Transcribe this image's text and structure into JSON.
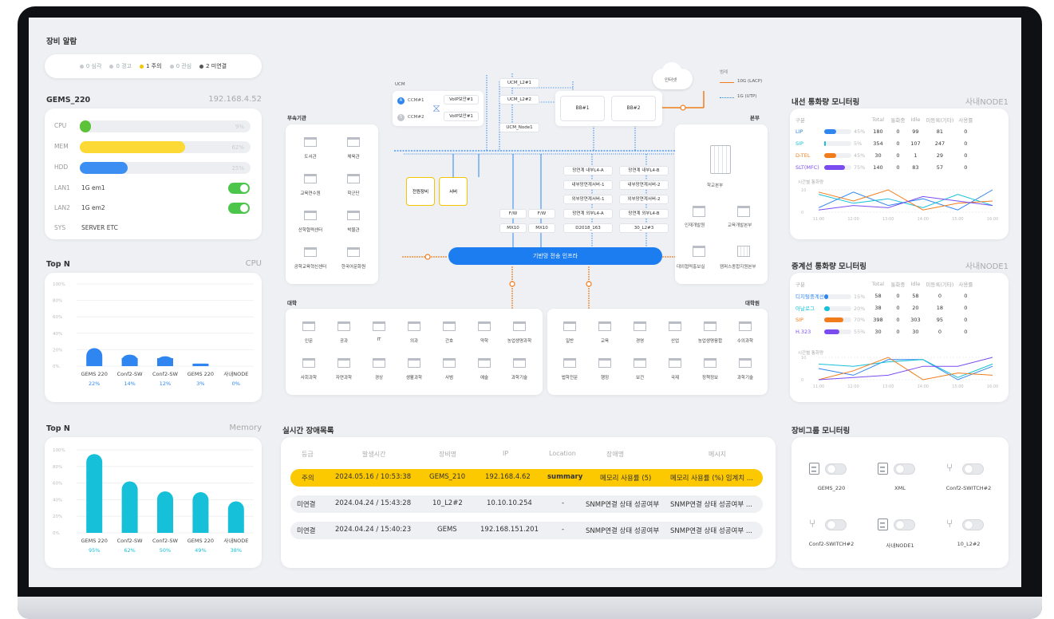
{
  "alarm": {
    "title": "장비 알람",
    "items": [
      {
        "label": "0 심각",
        "color": "#c7cbd1"
      },
      {
        "label": "0 경고",
        "color": "#c7cbd1"
      },
      {
        "label": "1 주의",
        "color": "#f2c500"
      },
      {
        "label": "0 관심",
        "color": "#c7cbd1"
      },
      {
        "label": "2 미연결",
        "color": "#555"
      }
    ]
  },
  "gems": {
    "title": "GEMS_220",
    "ip": "192.168.4.52",
    "rows": [
      {
        "label": "CPU",
        "percent": "9%",
        "fraction": 0.09,
        "color": "#5cc23a"
      },
      {
        "label": "MEM",
        "percent": "62%",
        "fraction": 0.62,
        "color": "#fcd934"
      },
      {
        "label": "HDD",
        "percent": "25%",
        "fraction": 0.25,
        "color": "#3c8ef2"
      }
    ],
    "lan1": {
      "label": "LAN1",
      "value": "1G em1",
      "on": true
    },
    "lan2": {
      "label": "LAN2",
      "value": "1G em2",
      "on": true
    },
    "sys": {
      "label": "SYS",
      "value": "SERVER ETC"
    }
  },
  "topn_cpu": {
    "title": "Top N",
    "subtitle": "CPU",
    "yticks": [
      "100%",
      "80%",
      "60%",
      "40%",
      "20%",
      "0%"
    ]
  },
  "topn_mem": {
    "title": "Top N",
    "subtitle": "Memory",
    "yticks": [
      "100%",
      "80%",
      "60%",
      "40%",
      "20%",
      "0%"
    ]
  },
  "chart_data": [
    {
      "type": "bar",
      "title": "Top N",
      "subtitle": "CPU",
      "categories": [
        "GEMS 220",
        "Conf2-SW",
        "Conf2-SW",
        "GEMS 220",
        "사내NODE"
      ],
      "values": [
        22,
        14,
        12,
        3,
        0
      ],
      "value_labels": [
        "22%",
        "14%",
        "12%",
        "3%",
        "0%"
      ],
      "ylim": [
        0,
        100
      ],
      "color": "#2f86f0"
    },
    {
      "type": "bar",
      "title": "Top N",
      "subtitle": "Memory",
      "categories": [
        "GEMS 220",
        "Conf2-SW",
        "Conf2-SW",
        "GEMS 220",
        "사내NODE"
      ],
      "values": [
        95,
        62,
        50,
        49,
        38
      ],
      "value_labels": [
        "95%",
        "62%",
        "50%",
        "49%",
        "38%"
      ],
      "ylim": [
        0,
        100
      ],
      "color": "#16c0d8"
    },
    {
      "type": "line",
      "title": "시간별 통화량",
      "x": [
        "11:00",
        "12:00",
        "13:00",
        "14:00",
        "15:00",
        "16:00"
      ],
      "yticks": [
        "10",
        "0"
      ],
      "ylim": [
        0,
        10
      ],
      "series": [
        {
          "color": "#2f86f0",
          "values": [
            2,
            9,
            3,
            6,
            1,
            10
          ]
        },
        {
          "color": "#16c0d8",
          "values": [
            8,
            4,
            6,
            2,
            8,
            3
          ]
        },
        {
          "color": "#f07c1b",
          "values": [
            9,
            5,
            10,
            1,
            4,
            5
          ]
        },
        {
          "color": "#7a4cf0",
          "values": [
            1,
            3,
            2,
            7,
            5,
            3
          ]
        }
      ]
    },
    {
      "type": "line",
      "title": "시간별 통화량",
      "x": [
        "11:00",
        "12:00",
        "13:00",
        "14:00",
        "15:00",
        "16:00"
      ],
      "yticks": [
        "10",
        "0"
      ],
      "ylim": [
        0,
        10
      ],
      "series": [
        {
          "color": "#2f86f0",
          "values": [
            5,
            2,
            9,
            9,
            0,
            6
          ]
        },
        {
          "color": "#16c0d8",
          "values": [
            7,
            6,
            8,
            9,
            1,
            7
          ]
        },
        {
          "color": "#f07c1b",
          "values": [
            0,
            4,
            10,
            0,
            3,
            2
          ]
        },
        {
          "color": "#7a4cf0",
          "values": [
            0,
            1,
            2,
            6,
            6,
            10
          ]
        }
      ]
    }
  ],
  "network": {
    "ucm": "UCM",
    "ccm1": "CCM#1",
    "ccm2": "CCM#2",
    "voip1": "VoIP보안#1",
    "voip2": "VoIP보안#1",
    "ucm_l2_1": "UCM_L2#1",
    "ucm_l2_2": "UCM_L2#2",
    "ucm_node1": "UCM_Node1",
    "bb1": "BB#1",
    "bb2": "BB#2",
    "internet": "인터넷",
    "legend_title": "범례",
    "legend_10g": "10G (LACP)",
    "legend_1g": "1G (UTP)",
    "affiliates_title": "부속기관",
    "affiliates": [
      "도서관",
      "체육관",
      "교육연수원",
      "학군단",
      "산학협력센터",
      "박물관",
      "공학교육혁신센터",
      "한국어문화원"
    ],
    "hq_title": "본부",
    "hq_main": "학교본부",
    "hq_items": [
      "인재개발원",
      "교육개발본부",
      "대외협력홍보실",
      "캠퍼스종합지원본부"
    ],
    "power": "전원장비",
    "server": "서버",
    "fw1": "F/W",
    "fw2": "F/W",
    "mx1": "MX10",
    "mx2": "MX10",
    "nodes_left": [
      "망연계 내부L4-A",
      "내부망연계서버-1",
      "외부망연계서버-1",
      "망연계 외부L4-A",
      "D2018_163"
    ],
    "nodes_right": [
      "망연계 내부L4-B",
      "내부망연계서버-2",
      "외부망연계서버-2",
      "망연계 외부L4-B",
      "30_L2#3"
    ],
    "backbone": "기반망 전송 인프라",
    "univ_title": "대학",
    "univ_row1": [
      "인문",
      "공과",
      "IT",
      "의과",
      "간호",
      "약학",
      "농업생명과학"
    ],
    "univ_row2": [
      "사회과학",
      "자연과학",
      "경상",
      "생활과학",
      "사범",
      "예술",
      "과학기술"
    ],
    "grad_title": "대학원",
    "grad_row1": [
      "일반",
      "교육",
      "경영",
      "산업",
      "농업생명융합",
      "수의과학"
    ],
    "grad_row2": [
      "법학전문",
      "행정",
      "보건",
      "국제",
      "정책정보",
      "과학기술"
    ]
  },
  "realtime": {
    "title": "실시간 장애목록",
    "headers": [
      "등급",
      "발생시간",
      "장비명",
      "IP",
      "Location",
      "장애명",
      "메시지"
    ],
    "rows": [
      {
        "grade": "주의",
        "time": "2024.05.16 / 10:53:38",
        "device": "GEMS_210",
        "ip": "192.168.4.62",
        "location": "summary",
        "name": "메모리 사용률 (5)",
        "msg": "메모리 사용률 (%) 임계치 ...",
        "highlight": true
      },
      {
        "grade": "미연결",
        "time": "2024.04.24 / 15:43:28",
        "device": "10_L2#2",
        "ip": "10.10.10.254",
        "location": "-",
        "name": "SNMP연결 상태 성공여부",
        "msg": "SNMP연결 상태 성공여부 ...",
        "highlight": false
      },
      {
        "grade": "미연결",
        "time": "2024.04.24 / 15:40:23",
        "device": "GEMS",
        "ip": "192.168.151.201",
        "location": "-",
        "name": "SNMP연결 상태 성공여부",
        "msg": "SNMP연결 상태 성공여부 ...",
        "highlight": false
      }
    ]
  },
  "inner_call": {
    "title": "내선 통화량 모니터링",
    "node": "사내NODE1",
    "headers": [
      "구분",
      "Total",
      "통화중",
      "Idle",
      "미등록(기타)",
      "사용률"
    ],
    "rows": [
      {
        "name": "LIP",
        "color": "#2f86f0",
        "pct": "45%",
        "fill": 0.45,
        "total": "180",
        "busy": "0",
        "idle": "99",
        "unreg": "81",
        "use": "0"
      },
      {
        "name": "SIP",
        "color": "#16c0d8",
        "pct": "5%",
        "fill": 0.05,
        "total": "354",
        "busy": "0",
        "idle": "107",
        "unreg": "247",
        "use": "0"
      },
      {
        "name": "D-TEL",
        "color": "#f07c1b",
        "pct": "45%",
        "fill": 0.45,
        "total": "30",
        "busy": "0",
        "idle": "1",
        "unreg": "29",
        "use": "0"
      },
      {
        "name": "SLT(MFC)",
        "color": "#7a4cf0",
        "pct": "75%",
        "fill": 0.75,
        "total": "140",
        "busy": "0",
        "idle": "83",
        "unreg": "57",
        "use": "0"
      }
    ],
    "chart_title": "시간별 통화량"
  },
  "trunk_call": {
    "title": "중계선 통화량 모니터링",
    "node": "사내NODE1",
    "headers": [
      "구분",
      "Total",
      "통화중",
      "Idle",
      "미등록(기타)",
      "사용률"
    ],
    "rows": [
      {
        "name": "디지털중계선",
        "color": "#2f86f0",
        "pct": "15%",
        "fill": 0.15,
        "total": "58",
        "busy": "0",
        "idle": "58",
        "unreg": "0",
        "use": "0"
      },
      {
        "name": "아날로그",
        "color": "#16c0d8",
        "pct": "20%",
        "fill": 0.2,
        "total": "38",
        "busy": "0",
        "idle": "20",
        "unreg": "18",
        "use": "0"
      },
      {
        "name": "SIP",
        "color": "#f07c1b",
        "pct": "70%",
        "fill": 0.7,
        "total": "398",
        "busy": "0",
        "idle": "303",
        "unreg": "95",
        "use": "0"
      },
      {
        "name": "H.323",
        "color": "#7a4cf0",
        "pct": "55%",
        "fill": 0.55,
        "total": "30",
        "busy": "0",
        "idle": "30",
        "unreg": "0",
        "use": "0"
      }
    ],
    "chart_title": "시간별 통화량"
  },
  "group": {
    "title": "장비그룹 모니터링",
    "items": [
      {
        "name": "GEMS_220",
        "icon": "server-icon"
      },
      {
        "name": "XML",
        "icon": "server-icon"
      },
      {
        "name": "Conf2-SWITCH#2",
        "icon": "switch-icon"
      },
      {
        "name": "Conf2-SWITCH#2",
        "icon": "switch-icon"
      },
      {
        "name": "사내NODE1",
        "icon": "server-icon"
      },
      {
        "name": "10_L2#2",
        "icon": "switch-icon"
      }
    ]
  }
}
